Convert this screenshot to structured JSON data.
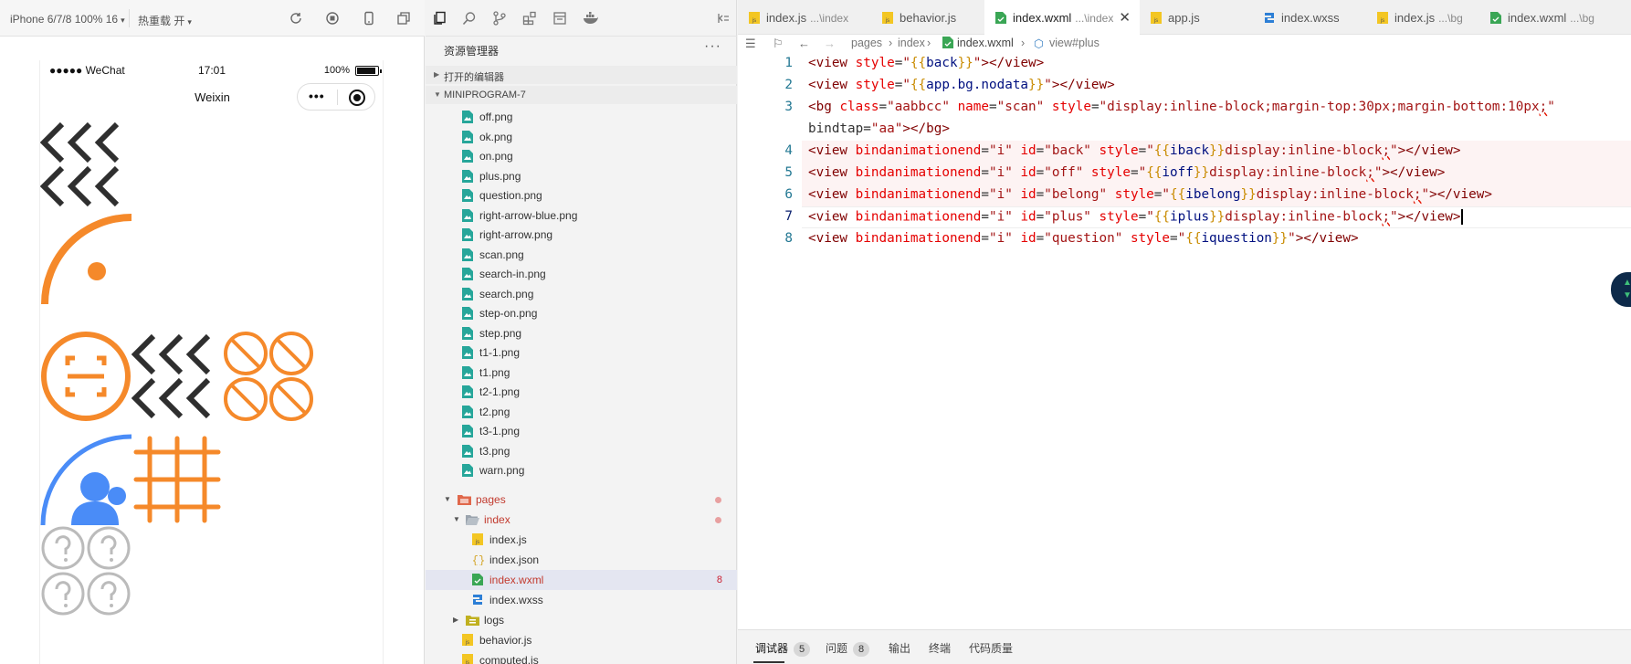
{
  "simulator": {
    "device_label": "iPhone 6/7/8 100% 16",
    "hotreload_label": "热重载 开",
    "status": {
      "carrier": "●●●●● WeChat",
      "time": "17:01",
      "battery": "100%"
    },
    "nav_title": "Weixin",
    "capsule_more": "•••"
  },
  "explorer": {
    "title": "资源管理器",
    "more": "···",
    "section_open_editors": "打开的编辑器",
    "section_project": "MINIPROGRAM-7",
    "files": [
      {
        "name": "off.png",
        "kind": "image"
      },
      {
        "name": "ok.png",
        "kind": "image"
      },
      {
        "name": "on.png",
        "kind": "image"
      },
      {
        "name": "plus.png",
        "kind": "image"
      },
      {
        "name": "question.png",
        "kind": "image"
      },
      {
        "name": "right-arrow-blue.png",
        "kind": "image"
      },
      {
        "name": "right-arrow.png",
        "kind": "image"
      },
      {
        "name": "scan.png",
        "kind": "image"
      },
      {
        "name": "search-in.png",
        "kind": "image"
      },
      {
        "name": "search.png",
        "kind": "image"
      },
      {
        "name": "step-on.png",
        "kind": "image"
      },
      {
        "name": "step.png",
        "kind": "image"
      },
      {
        "name": "t1-1.png",
        "kind": "image"
      },
      {
        "name": "t1.png",
        "kind": "image"
      },
      {
        "name": "t2-1.png",
        "kind": "image"
      },
      {
        "name": "t2.png",
        "kind": "image"
      },
      {
        "name": "t3-1.png",
        "kind": "image"
      },
      {
        "name": "t3.png",
        "kind": "image"
      },
      {
        "name": "warn.png",
        "kind": "image"
      }
    ],
    "folder_pages": "pages",
    "folder_index": "index",
    "index_files": [
      {
        "name": "index.js",
        "kind": "js"
      },
      {
        "name": "index.json",
        "kind": "json"
      },
      {
        "name": "index.wxml",
        "kind": "wxml",
        "count": "8"
      },
      {
        "name": "index.wxss",
        "kind": "wxss"
      }
    ],
    "folder_logs": "logs",
    "root_files": [
      {
        "name": "behavior.js",
        "kind": "js"
      },
      {
        "name": "computed.js",
        "kind": "js"
      }
    ]
  },
  "editor": {
    "tabs": [
      {
        "name": "index.js",
        "path": "...\\index",
        "kind": "js"
      },
      {
        "name": "behavior.js",
        "path": "",
        "kind": "js"
      },
      {
        "name": "index.wxml",
        "path": "...\\index",
        "kind": "wxml",
        "active": true
      },
      {
        "name": "app.js",
        "path": "",
        "kind": "js"
      },
      {
        "name": "index.wxss",
        "path": "",
        "kind": "wxss"
      },
      {
        "name": "index.js",
        "path": "...\\bg",
        "kind": "js"
      },
      {
        "name": "index.wxml",
        "path": "...\\bg",
        "kind": "wxml"
      }
    ],
    "close_glyph": "✕",
    "breadcrumb": [
      "pages",
      "index",
      "index.wxml",
      "view#plus"
    ],
    "line_numbers": [
      "1",
      "2",
      "3",
      "4",
      "5",
      "6",
      "7",
      "8"
    ],
    "code_lines": [
      "<view style=\"{{back}}\"></view>",
      "<view style=\"{{app.bg.nodata}}\"></view>",
      "<bg class=\"aabbcc\" name=\"scan\" style=\"display:inline-block;margin-top:30px;margin-bottom:10px;\"",
      "bindtap=\"aa\"></bg>",
      "<view bindanimationend=\"i\" id=\"back\" style=\"{{iback}}display:inline-block;\"></view>",
      "<view bindanimationend=\"i\" id=\"off\" style=\"{{ioff}}display:inline-block;\"></view>",
      "<view bindanimationend=\"i\" id=\"belong\" style=\"{{ibelong}}display:inline-block;\"></view>",
      "<view bindanimationend=\"i\" id=\"plus\" style=\"{{iplus}}display:inline-block;\"></view>",
      "<view bindanimationend=\"i\" id=\"question\" style=\"{{iquestion}}\"></view>"
    ],
    "bottom_tabs": [
      {
        "label": "调试器",
        "badge": "5"
      },
      {
        "label": "问题",
        "badge": "8"
      },
      {
        "label": "输出",
        "badge": ""
      },
      {
        "label": "终端",
        "badge": ""
      },
      {
        "label": "代码质量",
        "badge": ""
      }
    ]
  },
  "colors": {
    "accent_orange": "#f5892a",
    "accent_blue": "#4a8cf7",
    "gray_icon": "#bbbbbb",
    "dark_chevron": "#2f2f2f"
  }
}
